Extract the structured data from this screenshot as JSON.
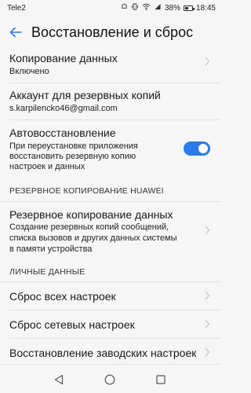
{
  "status_bar": {
    "carrier": "Tele2",
    "battery": "38%",
    "time": "18:45"
  },
  "header": {
    "title": "Восстановление и сброс"
  },
  "items": {
    "copy_data": {
      "title": "Копирование данных",
      "subtitle": "Включено"
    },
    "backup_account": {
      "title": "Аккаунт для резервных копий",
      "subtitle": "s.karpilencko46@gmail.com"
    },
    "auto_restore": {
      "title": "Автовосстановление",
      "subtitle_lines": [
        "При переустановке приложения",
        "восстановить резервную копию",
        "настроек и данных"
      ],
      "enabled": true
    }
  },
  "sections": {
    "huawei_backup": "РЕЗЕРВНОЕ КОПИРОВАНИЕ HUAWEI",
    "personal_data": "ЛИЧНЫЕ ДАННЫЕ"
  },
  "huawei_item": {
    "title": "Резервное копирование данных",
    "subtitle_lines": [
      "Создание резервных копий сообщений,",
      "списка вызовов и других данных системы",
      "в памяти устройства"
    ]
  },
  "reset_items": {
    "all_settings": "Сброс всех настроек",
    "network_settings": "Сброс сетевых настроек",
    "factory_reset": "Восстановление заводских настроек"
  },
  "colors": {
    "accent": "#2d7be8",
    "background": "#f6f6f6"
  }
}
